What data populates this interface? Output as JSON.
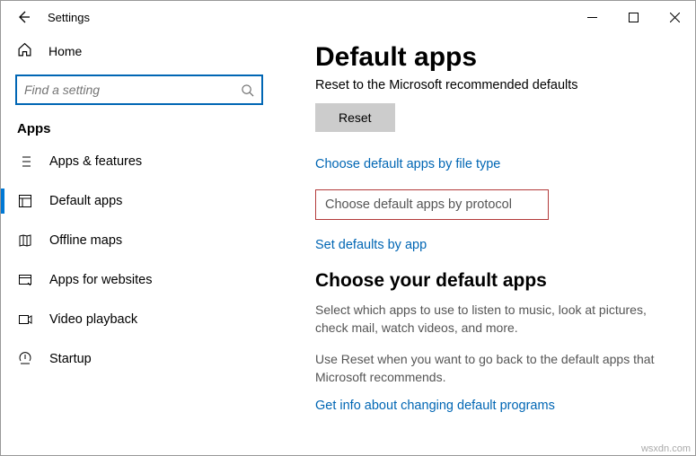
{
  "window": {
    "title": "Settings"
  },
  "sidebar": {
    "home_label": "Home",
    "search_placeholder": "Find a setting",
    "heading": "Apps",
    "items": [
      {
        "label": "Apps & features"
      },
      {
        "label": "Default apps"
      },
      {
        "label": "Offline maps"
      },
      {
        "label": "Apps for websites"
      },
      {
        "label": "Video playback"
      },
      {
        "label": "Startup"
      }
    ]
  },
  "main": {
    "title": "Default apps",
    "reset_caption": "Reset to the Microsoft recommended defaults",
    "reset_button": "Reset",
    "link_filetype": "Choose default apps by file type",
    "link_protocol": "Choose default apps by protocol",
    "link_byapp": "Set defaults by app",
    "choose_heading": "Choose your default apps",
    "choose_para": "Select which apps to use to listen to music, look at pictures, check mail, watch videos, and more.",
    "reset_para": "Use Reset when you want to go back to the default apps that Microsoft recommends.",
    "link_info": "Get info about changing default programs"
  },
  "watermark": "wsxdn.com"
}
